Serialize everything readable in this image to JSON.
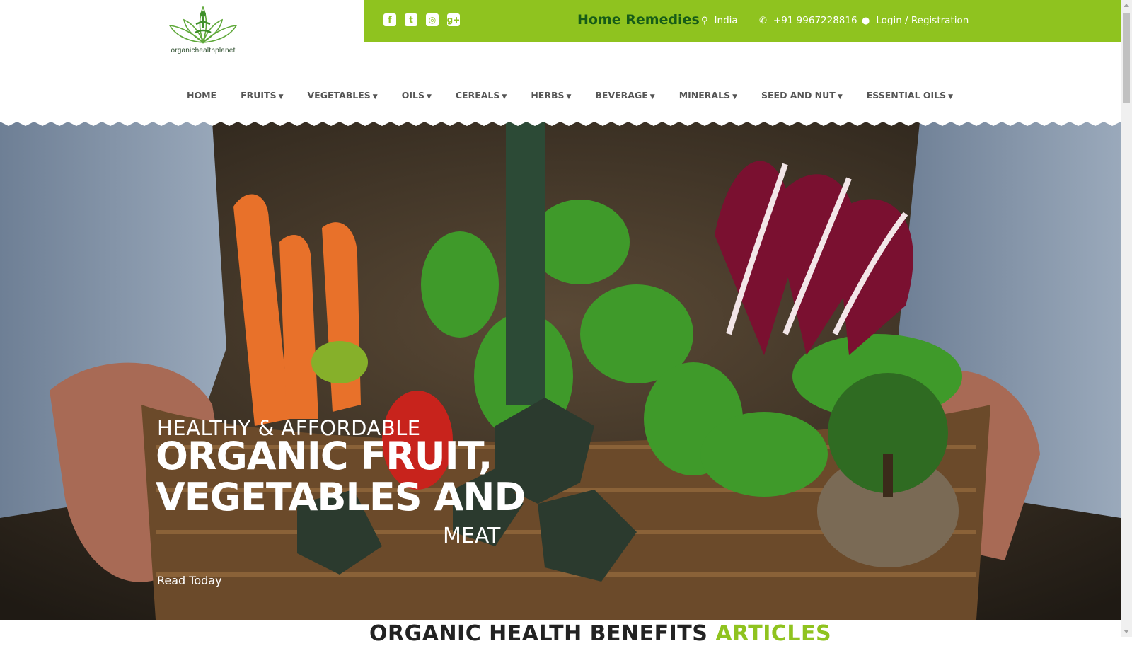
{
  "brand": {
    "logo_text": "organichealthplanet"
  },
  "topbar": {
    "social": [
      {
        "icon": "facebook-icon",
        "glyph": "f"
      },
      {
        "icon": "twitter-icon",
        "glyph": "t"
      },
      {
        "icon": "instagram-icon",
        "glyph": "◎"
      },
      {
        "icon": "google-plus-icon",
        "glyph": "g+"
      }
    ],
    "remedies_label": "Home Remedies",
    "location_icon": "map-marker-icon",
    "location": "India",
    "phone_icon": "phone-icon",
    "phone": "+91 9967228816",
    "user_icon": "user-icon",
    "login_label": "Login / Registration",
    "color": "#8fc31f"
  },
  "nav": {
    "items": [
      {
        "label": "HOME",
        "dropdown": false
      },
      {
        "label": "FRUITS",
        "dropdown": true
      },
      {
        "label": "VEGETABLES",
        "dropdown": true
      },
      {
        "label": "OILS",
        "dropdown": true
      },
      {
        "label": "CEREALS",
        "dropdown": true
      },
      {
        "label": "HERBS",
        "dropdown": true
      },
      {
        "label": "BEVERAGE",
        "dropdown": true
      },
      {
        "label": "MINERALS",
        "dropdown": true
      },
      {
        "label": "SEED AND NUT",
        "dropdown": true
      },
      {
        "label": "ESSENTIAL OILS",
        "dropdown": true
      }
    ]
  },
  "hero": {
    "subtitle": "HEALTHY & AFFORDABLE",
    "title_line1": "ORGANIC FRUIT,",
    "title_line2": "VEGETABLES AND",
    "title_line3": "MEAT",
    "cta": "Read Today"
  },
  "section": {
    "title_main": "ORGANIC HEALTH BENEFITS",
    "title_accent": "ARTICLES"
  }
}
